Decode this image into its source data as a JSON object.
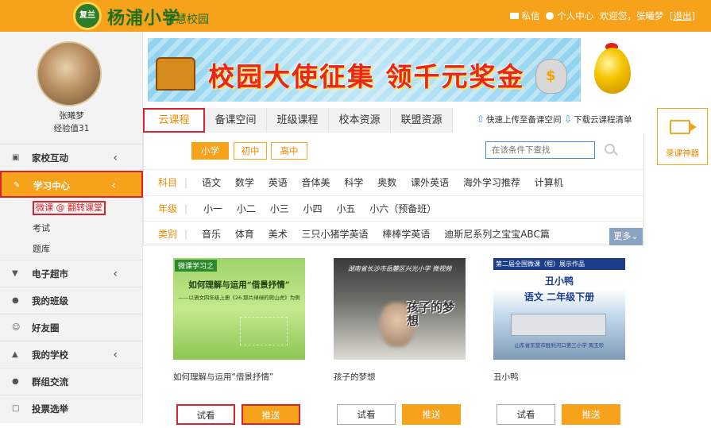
{
  "header": {
    "logo_text": "杨浦小学",
    "logo_subtext": "智慧校园",
    "logo_badge": "复兰",
    "messages": "私信",
    "personal_center": "个人中心",
    "welcome": "欢迎您，张曦梦",
    "logout": "[退出]"
  },
  "user": {
    "name": "张曦梦",
    "exp": "经验值31"
  },
  "sidebar": {
    "items": [
      {
        "label": "家校互动"
      },
      {
        "label": "学习中心"
      },
      {
        "label": "电子超市"
      },
      {
        "label": "我的班级"
      },
      {
        "label": "好友圈"
      },
      {
        "label": "我的学校"
      },
      {
        "label": "群组交流"
      },
      {
        "label": "投票选举"
      }
    ],
    "sub_items": [
      {
        "label": "微课 @ 翻转课堂"
      },
      {
        "label": "考试"
      },
      {
        "label": "题库"
      }
    ]
  },
  "banner": {
    "text": "校园大使征集  领千元奖金"
  },
  "tabs": [
    {
      "label": "云课程"
    },
    {
      "label": "备课空间"
    },
    {
      "label": "班级课程"
    },
    {
      "label": "校本资源"
    },
    {
      "label": "联盟资源"
    }
  ],
  "actions": {
    "upload": "快速上传至备课空间",
    "download": "下载云课程清单",
    "record": "录课神器"
  },
  "filters": {
    "levels": [
      {
        "label": "小学"
      },
      {
        "label": "初中"
      },
      {
        "label": "高中"
      }
    ],
    "search_placeholder": "在该条件下查找",
    "subject_label": "科目",
    "subjects": [
      "语文",
      "数学",
      "英语",
      "音体美",
      "科学",
      "奥数",
      "课外英语",
      "海外学习推荐",
      "计算机"
    ],
    "grade_label": "年级",
    "grades": [
      "小一",
      "小二",
      "小三",
      "小四",
      "小五",
      "小六（预备班）"
    ],
    "category_label": "类别",
    "categories": [
      "音乐",
      "体育",
      "美术",
      "三只小猪学英语",
      "棒棒学英语",
      "迪斯尼系列之宝宝ABC篇"
    ],
    "more": "更多"
  },
  "videos": [
    {
      "title": "如何理解与运用“借景抒情”",
      "thumb_caption": "微课学习之",
      "thumb_line1": "如何理解与运用“借景抒情”",
      "thumb_line2": "——以语文四年级上册《26.那片绿绿的爬山虎》为例",
      "try_label": "试看",
      "push_label": "推送"
    },
    {
      "title": "孩子的梦想",
      "thumb_line1": "湖南省长沙市岳麓区兴光小学 微视频",
      "thumb_line2": "孩子的梦想",
      "try_label": "试看",
      "push_label": "推送"
    },
    {
      "title": "丑小鸭",
      "thumb_caption": "第二届全国微课（程）展示作品",
      "thumb_line1": "丑小鸭",
      "thumb_line2": "语文   二年级下册",
      "thumb_footer": "山东省东营市胜利河口第三小学 周玉珍",
      "try_label": "试看",
      "push_label": "推送"
    }
  ],
  "colors": {
    "accent": "#f7a21b",
    "highlight_border": "#d9232d",
    "link_blue": "#3a8ee6"
  }
}
